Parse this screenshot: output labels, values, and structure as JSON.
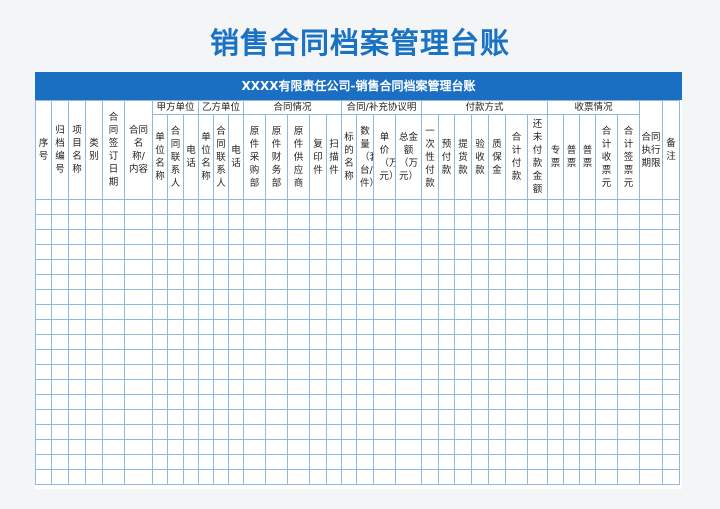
{
  "page": {
    "title": "销售合同档案管理台账"
  },
  "sheet": {
    "banner": "XXXX有限责任公司-销售合同档案管理台账",
    "groups": {
      "party_a": "甲方单位",
      "party_b": "乙方单位",
      "contract": "合同情况",
      "agreement": "合同/补充协议明",
      "payment": "付款方式",
      "invoice": "收票情况"
    },
    "columns": [
      "序号",
      "归档编号",
      "项目名称",
      "类别",
      "合同签订日期",
      "合同名称/内容",
      "单位名称",
      "合同联系人",
      "电话",
      "单位名称",
      "合同联系人",
      "电话",
      "原件采购部",
      "原件财务部",
      "原件供应商",
      "复印件",
      "扫描件",
      "标的名称",
      "数量（套/台/件）",
      "单价（万元）",
      "总金额（万元）",
      "一次性付款",
      "预付款",
      "提货款",
      "验收款",
      "质保金",
      "合计付款",
      "还未付款金额",
      "专票",
      "普票",
      "普票",
      "合计收票元",
      "合计签票元",
      "合同执行期限",
      "备注"
    ],
    "empty_rows": 19
  },
  "colors": {
    "accent": "#1a72c4",
    "banner": "#1a6fc2",
    "grid": "#8fb8e2"
  }
}
